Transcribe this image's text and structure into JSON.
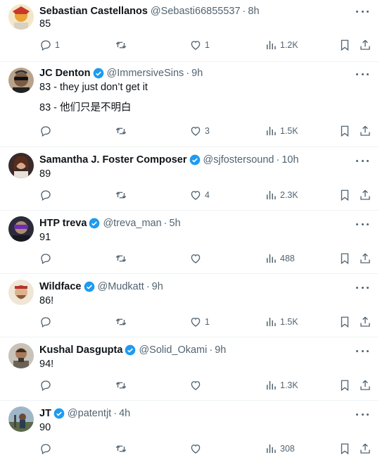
{
  "tweets": [
    {
      "name": "Sebastian Castellanos",
      "verified": false,
      "handle": "@Sebasti66855537",
      "time": "8h",
      "lines": [
        "85"
      ],
      "replies": "1",
      "retweets": "",
      "likes": "1",
      "views": "1.2K"
    },
    {
      "name": "JC Denton",
      "verified": true,
      "handle": "@ImmersiveSins",
      "time": "9h",
      "lines": [
        "83 - they just don’t get it",
        "83 - 他们只是不明白"
      ],
      "replies": "",
      "retweets": "",
      "likes": "3",
      "views": "1.5K"
    },
    {
      "name": "Samantha J. Foster Composer",
      "verified": true,
      "handle": "@sjfostersound",
      "time": "10h",
      "lines": [
        "89"
      ],
      "replies": "",
      "retweets": "",
      "likes": "4",
      "views": "2.3K"
    },
    {
      "name": "HTP treva",
      "verified": true,
      "handle": "@treva_man",
      "time": "5h",
      "lines": [
        "91"
      ],
      "replies": "",
      "retweets": "",
      "likes": "",
      "views": "488"
    },
    {
      "name": "Wildface",
      "verified": true,
      "handle": "@Mudkatt",
      "time": "9h",
      "lines": [
        "86!"
      ],
      "replies": "",
      "retweets": "",
      "likes": "1",
      "views": "1.5K"
    },
    {
      "name": "Kushal Dasgupta",
      "verified": true,
      "handle": "@Solid_Okami",
      "time": "9h",
      "lines": [
        "94!"
      ],
      "replies": "",
      "retweets": "",
      "likes": "",
      "views": "1.3K"
    },
    {
      "name": "JT",
      "verified": true,
      "handle": "@patentjt",
      "time": "4h",
      "lines": [
        "90"
      ],
      "replies": "",
      "retweets": "",
      "likes": "",
      "views": "308"
    }
  ],
  "separator": "·",
  "colors": {
    "text": "#0f1419",
    "secondary": "#536471",
    "verified": "#1d9bf0",
    "divider": "#eff3f4"
  },
  "icons": [
    "reply-icon",
    "retweet-icon",
    "like-icon",
    "views-icon",
    "bookmark-icon",
    "share-icon",
    "verified-badge-icon",
    "more-icon"
  ]
}
